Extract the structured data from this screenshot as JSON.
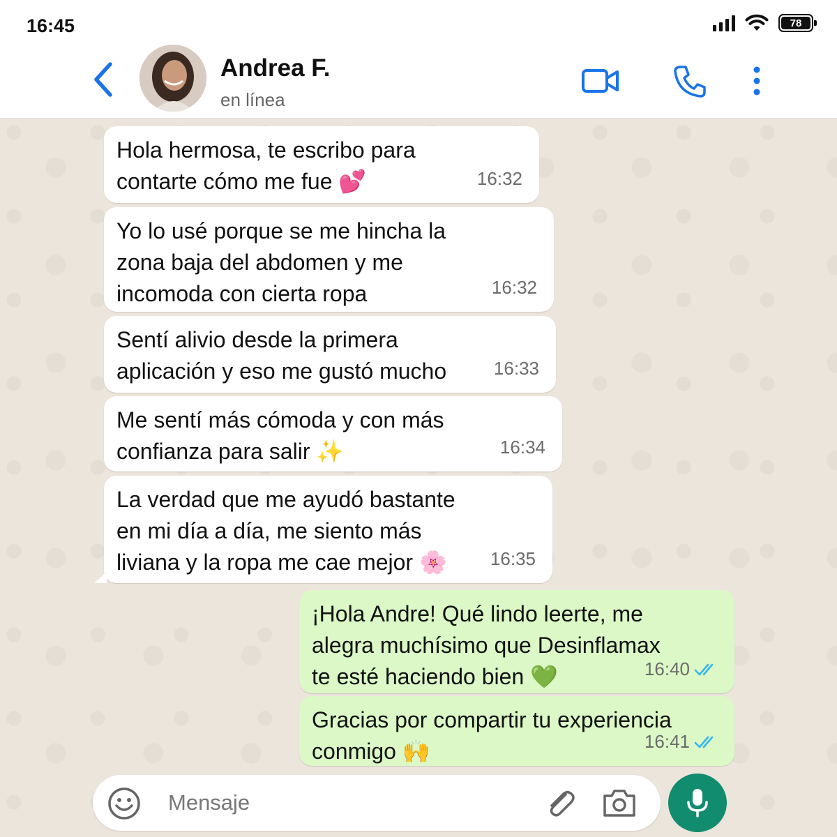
{
  "status_bar": {
    "time": "16:45",
    "battery": "78"
  },
  "contact": {
    "name": "Andrea F.",
    "status": "en línea"
  },
  "messages": [
    {
      "text": "Hola hermosa, te escribo para\ncontarte cómo me fue",
      "emoji": "💕",
      "time": "16:32",
      "direction": "incoming"
    },
    {
      "text": "Yo lo usé porque se me hincha la\nzona baja del abdomen y me\nincomoda con cierta ropa",
      "emoji": "",
      "time": "16:32",
      "direction": "incoming"
    },
    {
      "text": "Sentí alivio desde la primera\naplicación y eso me gustó mucho",
      "emoji": "",
      "time": "16:33",
      "direction": "incoming"
    },
    {
      "text": "Me sentí más cómoda y con más\nconfianza para salir",
      "emoji": "✨",
      "time": "16:34",
      "direction": "incoming"
    },
    {
      "text": "La verdad que me ayudó bastante\nen mi día a día, me siento más\nliviana y la ropa me cae mejor",
      "emoji": "🌸",
      "time": "16:35",
      "direction": "incoming"
    },
    {
      "text": "¡Hola Andre! Qué lindo leerte, me\nalegra muchísimo que Desinflamax\nte esté haciendo bien",
      "emoji": "💚",
      "time": "16:40",
      "direction": "outgoing"
    },
    {
      "text": "Gracias por compartir tu experiencia\nconmigo",
      "emoji": "🙌",
      "time": "16:41",
      "direction": "outgoing"
    }
  ],
  "input": {
    "placeholder": "Mensaje"
  },
  "icons": {
    "back": "chevron-left-icon",
    "video": "video-camera-icon",
    "call": "phone-icon",
    "menu": "more-vertical-icon",
    "emoji": "smiley-icon",
    "attach": "paperclip-icon",
    "camera": "camera-icon",
    "mic": "microphone-icon",
    "read_receipt": "double-check-icon"
  },
  "colors": {
    "accent_blue": "#1a73e8",
    "outgoing_bubble": "#dbf8c6",
    "incoming_bubble": "#ffffff",
    "mic_button": "#128c6e",
    "read_ticks": "#34b7f1"
  }
}
